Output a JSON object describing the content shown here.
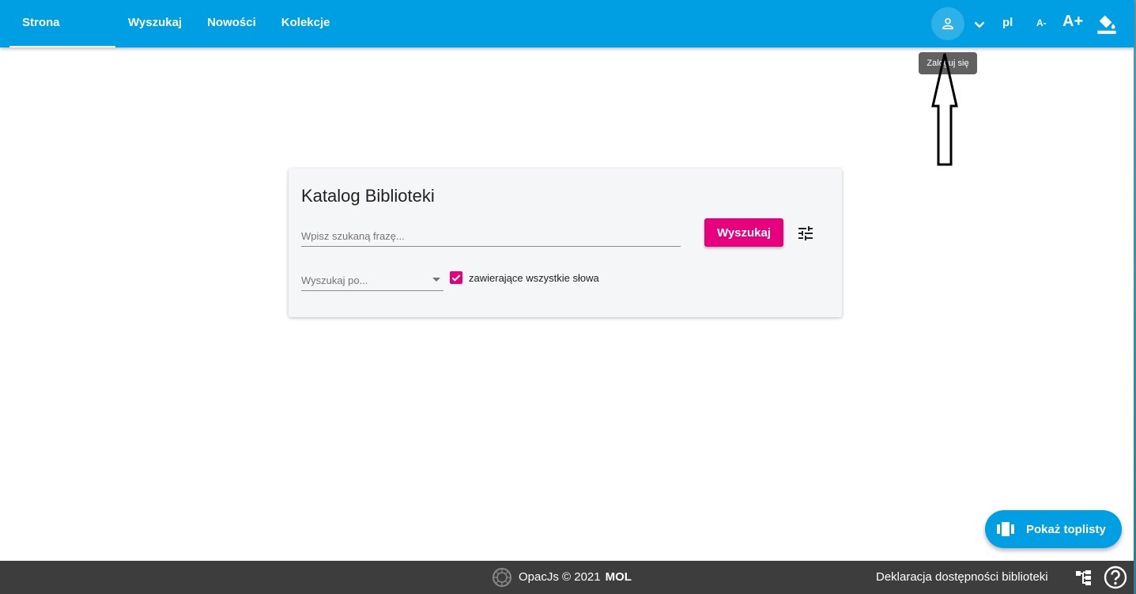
{
  "nav": {
    "tabs": [
      {
        "label": "Strona główna",
        "active": true
      },
      {
        "label": "Wyszukaj",
        "active": false
      },
      {
        "label": "Nowości",
        "active": false
      },
      {
        "label": "Kolekcje",
        "active": false
      }
    ]
  },
  "toolbar": {
    "account_icon": "person-icon",
    "account_tooltip": "Zaloguj się",
    "language": "pl",
    "font_decrease": "A-",
    "font_increase": "A+",
    "contrast_icon": "format-color-fill-icon"
  },
  "search": {
    "title": "Katalog Biblioteki",
    "placeholder": "Wpisz szukaną frazę...",
    "value": "",
    "button_label": "Wyszukaj",
    "search_by_placeholder": "Wyszukaj po...",
    "all_words_label": "zawierające wszystkie słowa",
    "all_words_checked": true
  },
  "fab": {
    "label": "Pokaż toplisty",
    "icon": "view-carousel-icon"
  },
  "footer": {
    "copyright": "OpacJs © 2021",
    "brand": "MOL",
    "accessibility_link": "Deklaracja dostępności biblioteki"
  },
  "colors": {
    "primary": "#009fe3",
    "accent": "#e6007e",
    "footer_bg": "#3d3d3d",
    "card_bg": "#f5f6f7"
  }
}
